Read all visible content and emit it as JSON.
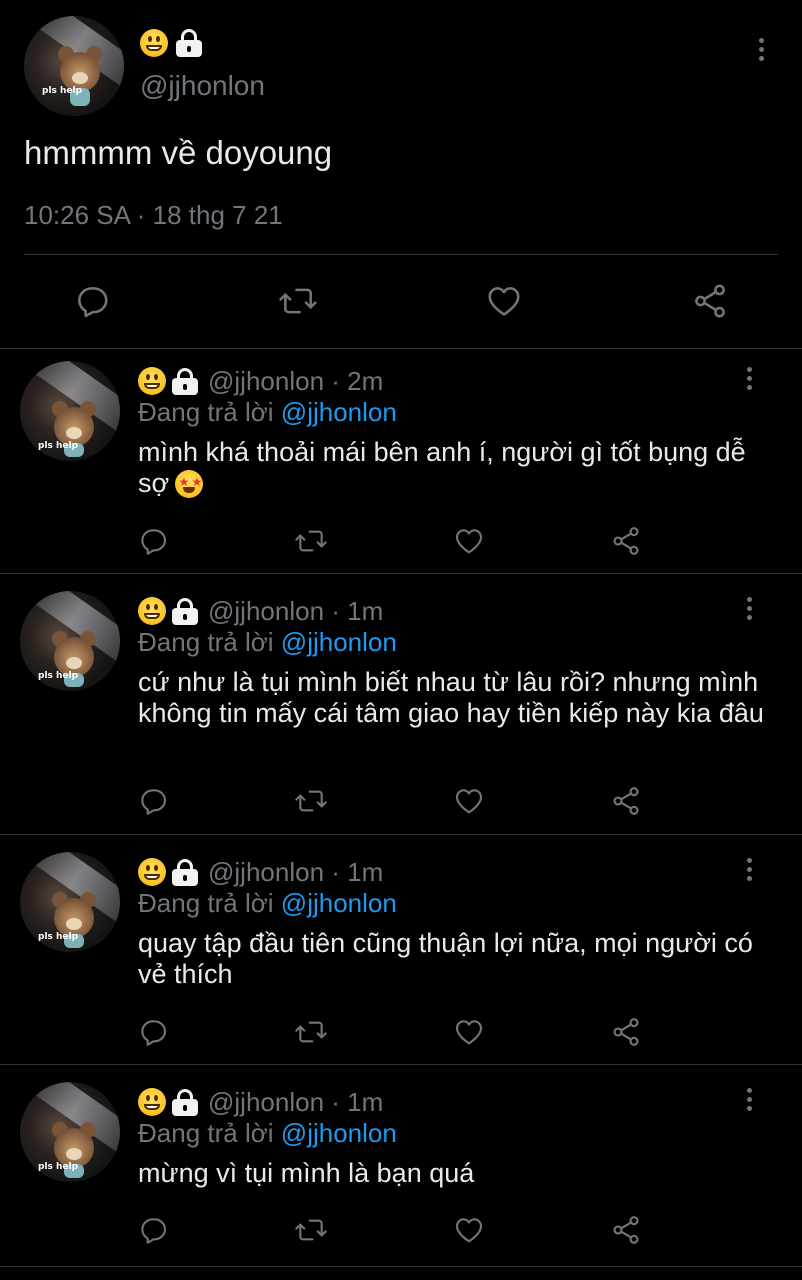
{
  "main_tweet": {
    "handle": "@jjhonlon",
    "text": "hmmmm về doyoung",
    "timestamp": "10:26 SA · 18 thg 7 21",
    "avatar_caption": "pls help"
  },
  "replies": [
    {
      "handle_line": "@jjhonlon · 2m",
      "replying_prefix": "Đang trả lời",
      "replying_to": "@jjhonlon",
      "text": "mình khá thoải mái bên anh í, người gì tốt bụng dễ sợ",
      "avatar_caption": "pls help"
    },
    {
      "handle_line": "@jjhonlon · 1m",
      "replying_prefix": "Đang trả lời",
      "replying_to": "@jjhonlon",
      "text": "cứ như là tụi mình biết nhau từ lâu rồi? nhưng mình không tin mấy cái tâm giao hay tiền kiếp này kia đâu",
      "avatar_caption": "pls help"
    },
    {
      "handle_line": "@jjhonlon · 1m",
      "replying_prefix": "Đang trả lời",
      "replying_to": "@jjhonlon",
      "text": "quay tập đầu tiên cũng thuận lợi nữa, mọi người có vẻ thích",
      "avatar_caption": "pls help"
    },
    {
      "handle_line": "@jjhonlon · 1m",
      "replying_prefix": "Đang trả lời",
      "replying_to": "@jjhonlon",
      "text": "mừng vì tụi mình là bạn quá",
      "avatar_caption": "pls help"
    }
  ],
  "icons": {
    "name_emojis": [
      "grinning-face-icon",
      "lock-icon"
    ],
    "actions": [
      "reply-icon",
      "retweet-icon",
      "like-icon",
      "share-icon"
    ],
    "reply_1_trailing_emoji": "star-struck-icon"
  },
  "colors": {
    "background": "#000000",
    "text_primary": "#e7e9ea",
    "text_secondary": "#71767b",
    "mention": "#1d9bf0",
    "divider": "#2f3336"
  }
}
